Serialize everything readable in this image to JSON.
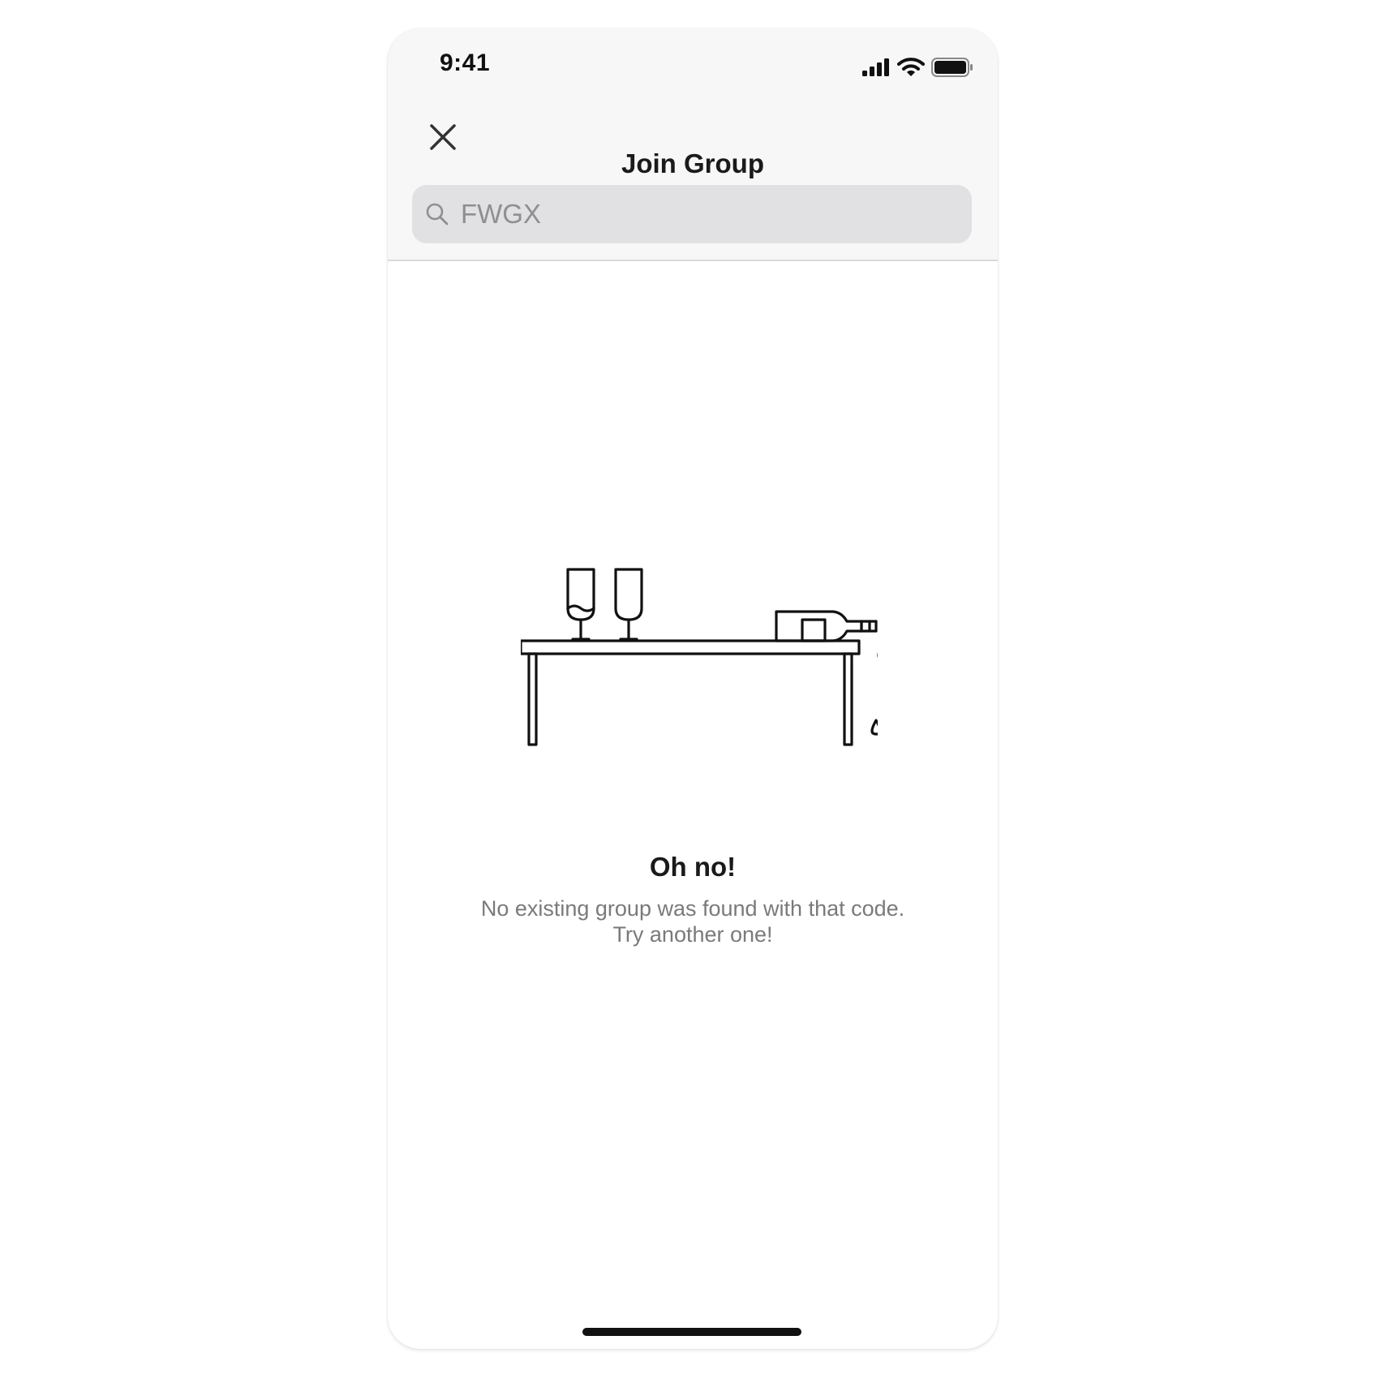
{
  "status_bar": {
    "time": "9:41",
    "icons": [
      "signal-icon",
      "wifi-icon",
      "battery-icon"
    ]
  },
  "nav": {
    "title": "Join Group",
    "close_icon": "close-icon"
  },
  "search": {
    "value": "FWGX",
    "icon": "search-icon"
  },
  "empty_state": {
    "illustration": "table-with-spilled-bottle-illustration",
    "title": "Oh no!",
    "message_line1": "No existing group was found with that code.",
    "message_line2": "Try another one!"
  },
  "colors": {
    "header_bg": "#f7f7f7",
    "search_bg": "#e1e1e3",
    "text_primary": "#1a1a1a",
    "text_secondary": "#7a7a7a"
  }
}
